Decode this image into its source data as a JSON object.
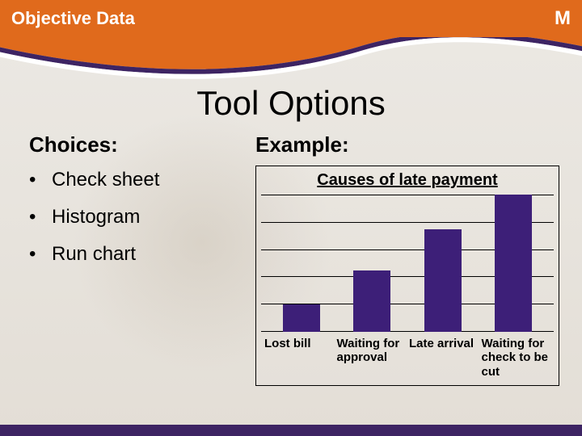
{
  "header": {
    "title": "Objective Data",
    "badge": "M"
  },
  "main_title": "Tool Options",
  "choices": {
    "heading": "Choices:",
    "items": [
      "Check sheet",
      "Histogram",
      "Run chart"
    ]
  },
  "example": {
    "heading": "Example:"
  },
  "chart_data": {
    "type": "bar",
    "title": "Causes of late payment",
    "categories": [
      "Lost bill",
      "Waiting for approval",
      "Late arrival",
      "Waiting for check to be cut"
    ],
    "values": [
      20,
      45,
      75,
      100
    ],
    "ylim": [
      0,
      100
    ],
    "gridlines": 6,
    "bar_color": "#3d1f78"
  }
}
